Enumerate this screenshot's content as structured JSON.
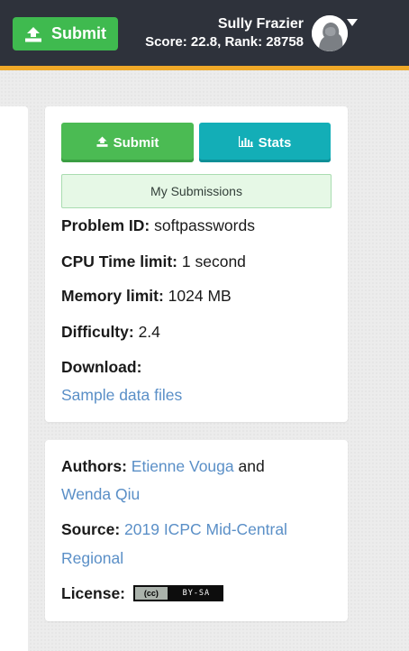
{
  "header": {
    "submit_label": "Submit",
    "user_name": "Sully Frazier",
    "user_stats": "Score: 22.8, Rank: 28758"
  },
  "sidebar": {
    "submit_label": "Submit",
    "stats_label": "Stats",
    "my_submissions_label": "My Submissions",
    "problem_id_label": "Problem ID:",
    "problem_id_value": "softpasswords",
    "cpu_label": "CPU Time limit:",
    "cpu_value": "1 second",
    "memory_label": "Memory limit:",
    "memory_value": "1024 MB",
    "difficulty_label": "Difficulty:",
    "difficulty_value": "2.4",
    "download_label": "Download:",
    "download_link": "Sample data files"
  },
  "meta": {
    "authors_label": "Authors:",
    "author_1": "Etienne Vouga",
    "authors_join": "and",
    "author_2": "Wenda Qiu",
    "source_label": "Source:",
    "source_line1": "2019 ICPC Mid-Central",
    "source_line2": "Regional",
    "license_label": "License:",
    "license_badge_left": "(cc)",
    "license_badge_right": "BY-SA"
  },
  "colors": {
    "topbar": "#2e323b",
    "accent_bar": "#f0a928",
    "submit_green": "#4bbb53",
    "stats_teal": "#13aeb7",
    "link_blue": "#5a8fc7"
  },
  "icons": {
    "submit": "upload-icon",
    "stats": "bar-chart-icon",
    "avatar_menu": "caret-down-icon"
  }
}
